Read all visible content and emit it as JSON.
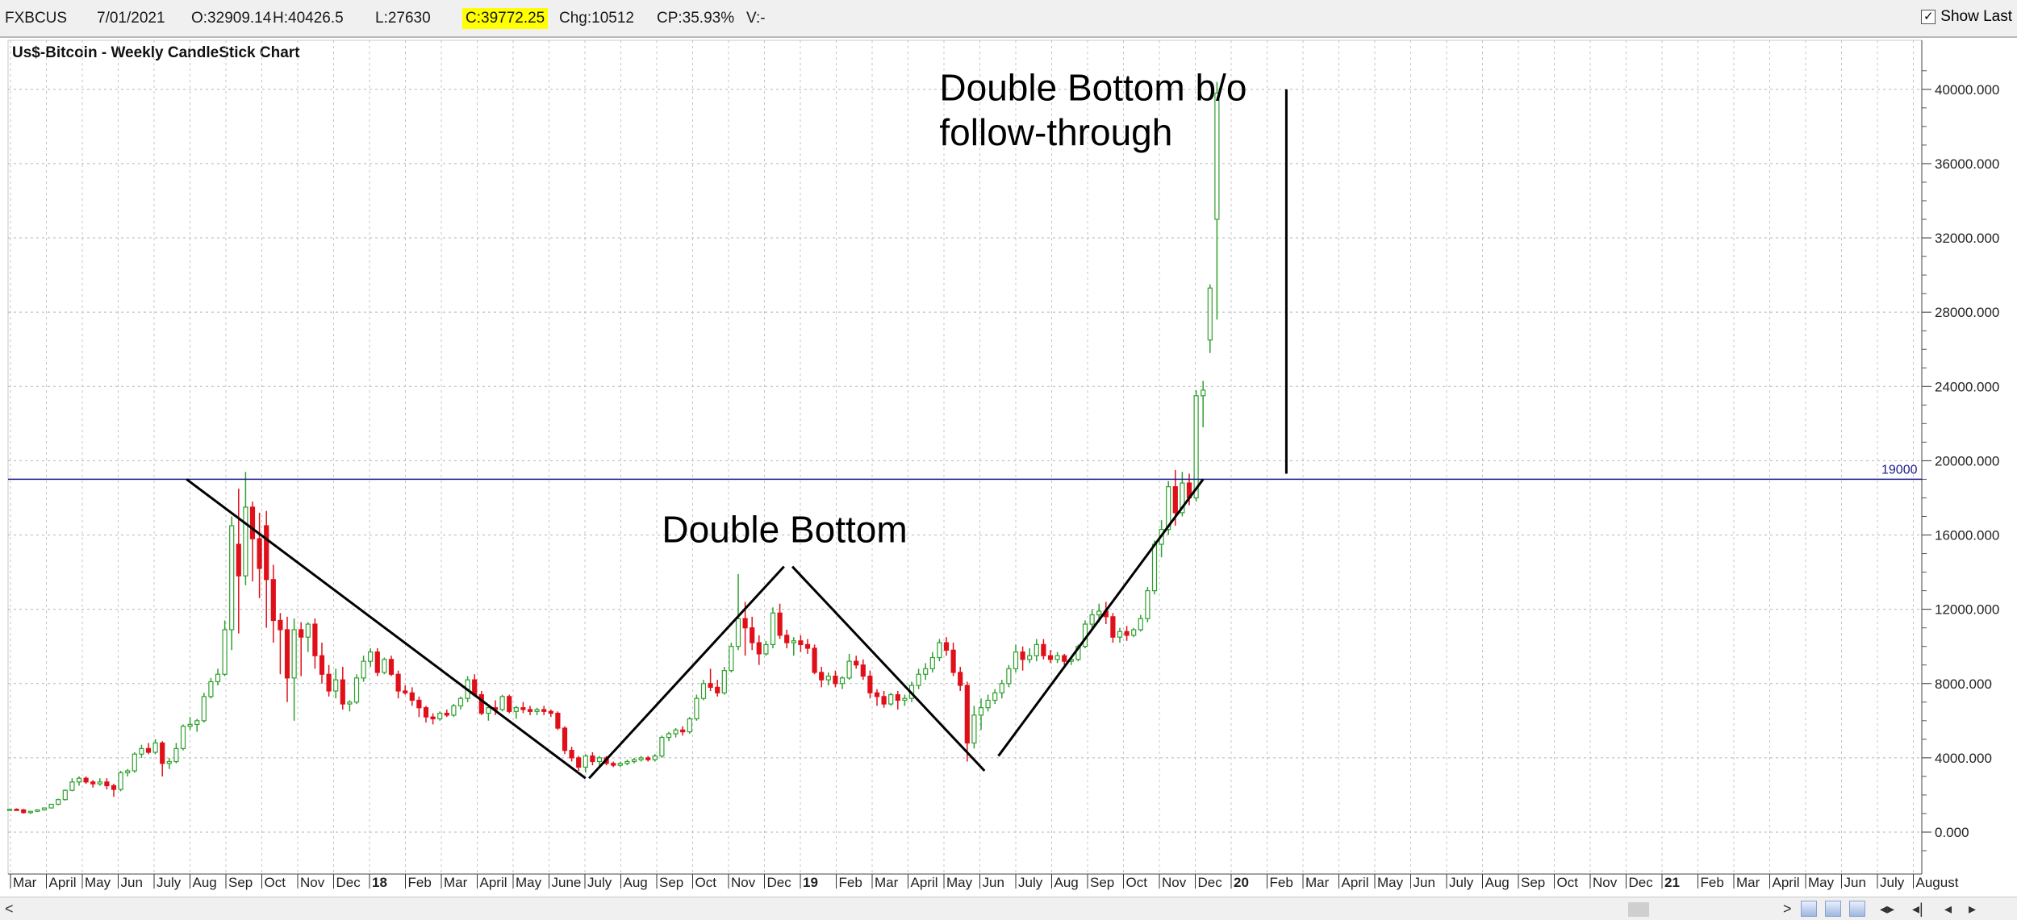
{
  "topbar": {
    "symbol": "FXBCUS",
    "date": "7/01/2021",
    "open": "O:32909.14",
    "high": "H:40426.5",
    "low": "L:27630",
    "close": "C:39772.25",
    "change": "Chg:10512",
    "change_pct": "CP:35.93%",
    "volume": "V:-",
    "show_last_label": "Show Last",
    "show_last_checked": true
  },
  "colors": {
    "up": "#2ea02e",
    "down": "#e0101a",
    "level_line": "#1c1c8c",
    "highlight": "#ffff00"
  },
  "chart_data": {
    "type": "candlestick",
    "title": "Us$-Bitcoin - Weekly CandleStick Chart",
    "ylim": [
      -1500,
      41500
    ],
    "y_ticks": [
      "0.000",
      "4000.000",
      "8000.000",
      "12000.000",
      "16000.000",
      "20000.000",
      "24000.000",
      "28000.000",
      "32000.000",
      "36000.000",
      "40000.000"
    ],
    "x_labels": [
      "Mar",
      "April",
      "May",
      "Jun",
      "July",
      "Aug",
      "Sep",
      "Oct",
      "Nov",
      "Dec",
      "18",
      "Feb",
      "Mar",
      "April",
      "May",
      "June",
      "July",
      "Aug",
      "Sep",
      "Oct",
      "Nov",
      "Dec",
      "19",
      "Feb",
      "Mar",
      "April",
      "May",
      "Jun",
      "July",
      "Aug",
      "Sep",
      "Oct",
      "Nov",
      "Dec",
      "20",
      "Feb",
      "Mar",
      "April",
      "May",
      "Jun",
      "July",
      "Aug",
      "Sep",
      "Oct",
      "Nov",
      "Dec",
      "21",
      "Feb",
      "Mar",
      "April",
      "May",
      "Jun",
      "July",
      "August"
    ],
    "bold_x_labels": [
      "18",
      "19",
      "20",
      "21"
    ],
    "horizontal_line": {
      "value": 19000,
      "label": "19000"
    },
    "candles": [
      [
        1200,
        1250,
        1180,
        1230
      ],
      [
        1230,
        1280,
        1150,
        1200
      ],
      [
        1200,
        1250,
        1000,
        1050
      ],
      [
        1050,
        1150,
        980,
        1120
      ],
      [
        1120,
        1220,
        1080,
        1200
      ],
      [
        1200,
        1320,
        1150,
        1300
      ],
      [
        1300,
        1520,
        1280,
        1500
      ],
      [
        1500,
        1800,
        1450,
        1750
      ],
      [
        1750,
        2300,
        1700,
        2250
      ],
      [
        2250,
        2900,
        2200,
        2700
      ],
      [
        2700,
        3000,
        2500,
        2900
      ],
      [
        2900,
        3000,
        2600,
        2700
      ],
      [
        2700,
        2800,
        2400,
        2600
      ],
      [
        2600,
        2900,
        2500,
        2700
      ],
      [
        2700,
        2900,
        2300,
        2500
      ],
      [
        2500,
        2600,
        1900,
        2300
      ],
      [
        2300,
        3300,
        2200,
        3200
      ],
      [
        3200,
        3400,
        3000,
        3300
      ],
      [
        3300,
        4300,
        3200,
        4200
      ],
      [
        4200,
        4700,
        4000,
        4500
      ],
      [
        4500,
        4800,
        4200,
        4300
      ],
      [
        4300,
        5000,
        4200,
        4800
      ],
      [
        4800,
        4900,
        3000,
        3700
      ],
      [
        3700,
        4000,
        3400,
        3800
      ],
      [
        3800,
        4800,
        3700,
        4500
      ],
      [
        4500,
        5800,
        4400,
        5700
      ],
      [
        5700,
        6200,
        5500,
        5800
      ],
      [
        5800,
        6100,
        5400,
        6000
      ],
      [
        6000,
        7500,
        5900,
        7300
      ],
      [
        7300,
        8300,
        7200,
        8100
      ],
      [
        8100,
        8800,
        7900,
        8500
      ],
      [
        8500,
        11400,
        8400,
        10900
      ],
      [
        10900,
        17000,
        9800,
        16500
      ],
      [
        15500,
        18500,
        10700,
        13800
      ],
      [
        13800,
        19400,
        13300,
        17500
      ],
      [
        17500,
        17800,
        13500,
        15800
      ],
      [
        15800,
        17200,
        12600,
        14200
      ],
      [
        16500,
        17300,
        11000,
        13600
      ],
      [
        13600,
        14400,
        10200,
        11400
      ],
      [
        11400,
        11800,
        8500,
        10900
      ],
      [
        10900,
        11600,
        7000,
        8300
      ],
      [
        8300,
        11500,
        6000,
        10900
      ],
      [
        10900,
        11300,
        8400,
        10500
      ],
      [
        10500,
        11300,
        9700,
        11200
      ],
      [
        11200,
        11500,
        8800,
        9500
      ],
      [
        9500,
        10200,
        8000,
        8500
      ],
      [
        8500,
        9000,
        7300,
        7600
      ],
      [
        7600,
        8800,
        7200,
        8200
      ],
      [
        8200,
        8900,
        6600,
        6900
      ],
      [
        6900,
        7100,
        6500,
        7000
      ],
      [
        7000,
        8500,
        6900,
        8300
      ],
      [
        8300,
        9500,
        8100,
        9200
      ],
      [
        9200,
        9900,
        8900,
        9700
      ],
      [
        9700,
        9900,
        8400,
        8600
      ],
      [
        8600,
        9400,
        8500,
        9300
      ],
      [
        9300,
        9500,
        8400,
        8500
      ],
      [
        8500,
        8700,
        7200,
        7600
      ],
      [
        7600,
        7900,
        7400,
        7500
      ],
      [
        7500,
        7800,
        6800,
        7100
      ],
      [
        7100,
        7300,
        6200,
        6700
      ],
      [
        6700,
        6800,
        5900,
        6200
      ],
      [
        6200,
        6400,
        5800,
        6100
      ],
      [
        6100,
        6500,
        6000,
        6400
      ],
      [
        6400,
        6600,
        6200,
        6300
      ],
      [
        6300,
        6900,
        6200,
        6800
      ],
      [
        6800,
        7300,
        6600,
        7200
      ],
      [
        7200,
        8400,
        7000,
        8200
      ],
      [
        8200,
        8500,
        7300,
        7400
      ],
      [
        7400,
        7600,
        6300,
        6400
      ],
      [
        6400,
        6800,
        6000,
        6700
      ],
      [
        6700,
        7100,
        6300,
        6600
      ],
      [
        6600,
        7400,
        6500,
        7300
      ],
      [
        7300,
        7400,
        6400,
        6500
      ],
      [
        6500,
        6800,
        6100,
        6700
      ],
      [
        6700,
        7000,
        6400,
        6600
      ],
      [
        6600,
        6800,
        6300,
        6500
      ],
      [
        6500,
        6700,
        6300,
        6600
      ],
      [
        6600,
        6800,
        6300,
        6500
      ],
      [
        6500,
        6600,
        6200,
        6400
      ],
      [
        6400,
        6500,
        5500,
        5600
      ],
      [
        5600,
        5700,
        4200,
        4400
      ],
      [
        4400,
        4600,
        3800,
        4000
      ],
      [
        4000,
        4100,
        3300,
        3500
      ],
      [
        3500,
        4200,
        3200,
        4100
      ],
      [
        4100,
        4300,
        3600,
        3800
      ],
      [
        3800,
        4100,
        3500,
        4000
      ],
      [
        4000,
        4100,
        3600,
        3700
      ],
      [
        3700,
        3800,
        3500,
        3600
      ],
      [
        3600,
        3800,
        3500,
        3700
      ],
      [
        3700,
        3900,
        3600,
        3800
      ],
      [
        3800,
        4000,
        3700,
        3900
      ],
      [
        3900,
        4100,
        3800,
        4000
      ],
      [
        4000,
        4100,
        3800,
        3900
      ],
      [
        3900,
        4200,
        3800,
        4100
      ],
      [
        4100,
        5200,
        4000,
        5100
      ],
      [
        5100,
        5400,
        4900,
        5300
      ],
      [
        5300,
        5600,
        5100,
        5500
      ],
      [
        5500,
        5700,
        5200,
        5400
      ],
      [
        5400,
        6200,
        5300,
        6100
      ],
      [
        6100,
        7400,
        6000,
        7200
      ],
      [
        7200,
        8200,
        7100,
        8000
      ],
      [
        8000,
        8800,
        7600,
        7800
      ],
      [
        7800,
        8200,
        7300,
        7500
      ],
      [
        7500,
        8900,
        7400,
        8700
      ],
      [
        8700,
        10200,
        8600,
        10000
      ],
      [
        10000,
        13900,
        9800,
        11500
      ],
      [
        11500,
        12400,
        9500,
        11000
      ],
      [
        11000,
        11600,
        9800,
        10200
      ],
      [
        10200,
        10600,
        9000,
        9600
      ],
      [
        9600,
        10300,
        9500,
        10100
      ],
      [
        10100,
        12100,
        9900,
        11800
      ],
      [
        11800,
        12300,
        10400,
        10600
      ],
      [
        10600,
        10900,
        9900,
        10200
      ],
      [
        10200,
        10500,
        9500,
        10300
      ],
      [
        10300,
        10600,
        9700,
        10100
      ],
      [
        10100,
        10400,
        9600,
        9900
      ],
      [
        9900,
        10100,
        8500,
        8600
      ],
      [
        8600,
        8900,
        7800,
        8200
      ],
      [
        8200,
        8600,
        7900,
        8400
      ],
      [
        8400,
        8700,
        7800,
        8000
      ],
      [
        8000,
        8400,
        7700,
        8300
      ],
      [
        8300,
        9600,
        8200,
        9200
      ],
      [
        9200,
        9500,
        8800,
        9000
      ],
      [
        9000,
        9300,
        8200,
        8400
      ],
      [
        8400,
        8700,
        7200,
        7500
      ],
      [
        7500,
        7700,
        6800,
        7300
      ],
      [
        7300,
        7600,
        6700,
        6900
      ],
      [
        6900,
        7500,
        6800,
        7400
      ],
      [
        7400,
        7600,
        6600,
        7100
      ],
      [
        7100,
        7400,
        6800,
        7200
      ],
      [
        7200,
        8100,
        7000,
        7900
      ],
      [
        7900,
        8800,
        7700,
        8500
      ],
      [
        8500,
        9100,
        8200,
        8800
      ],
      [
        8800,
        9700,
        8600,
        9400
      ],
      [
        9400,
        10400,
        9200,
        10200
      ],
      [
        10200,
        10500,
        9500,
        9800
      ],
      [
        9800,
        10200,
        8400,
        8600
      ],
      [
        8600,
        8900,
        7600,
        7900
      ],
      [
        7900,
        8100,
        3800,
        4800
      ],
      [
        4800,
        6800,
        4500,
        6300
      ],
      [
        6300,
        7200,
        5500,
        6700
      ],
      [
        6700,
        7400,
        6500,
        7100
      ],
      [
        7100,
        7700,
        6900,
        7500
      ],
      [
        7500,
        8200,
        7200,
        8000
      ],
      [
        8000,
        9000,
        7800,
        8800
      ],
      [
        8800,
        10100,
        8600,
        9700
      ],
      [
        9700,
        10000,
        8700,
        9300
      ],
      [
        9300,
        9900,
        9100,
        9500
      ],
      [
        9500,
        10400,
        9200,
        10100
      ],
      [
        10100,
        10400,
        9300,
        9500
      ],
      [
        9500,
        9800,
        9100,
        9300
      ],
      [
        9300,
        9700,
        9100,
        9500
      ],
      [
        9500,
        9600,
        9000,
        9200
      ],
      [
        9200,
        9400,
        9000,
        9300
      ],
      [
        9300,
        10100,
        9200,
        10000
      ],
      [
        10000,
        11400,
        9900,
        11200
      ],
      [
        11200,
        12000,
        10900,
        11700
      ],
      [
        11700,
        12300,
        11300,
        11900
      ],
      [
        11900,
        12400,
        11200,
        11600
      ],
      [
        11600,
        11800,
        10200,
        10500
      ],
      [
        10500,
        11000,
        10200,
        10800
      ],
      [
        10800,
        11100,
        10300,
        10600
      ],
      [
        10600,
        11000,
        10500,
        10900
      ],
      [
        10900,
        11700,
        10800,
        11500
      ],
      [
        11500,
        13200,
        11300,
        13000
      ],
      [
        13000,
        15700,
        12800,
        15500
      ],
      [
        15500,
        16800,
        14800,
        16300
      ],
      [
        16300,
        18900,
        16000,
        18600
      ],
      [
        18600,
        19500,
        16500,
        17200
      ],
      [
        17200,
        19400,
        17000,
        18800
      ],
      [
        18800,
        19300,
        17600,
        18000
      ],
      [
        18000,
        23800,
        17800,
        23500
      ],
      [
        23500,
        24300,
        21800,
        23800
      ],
      [
        26500,
        29500,
        25800,
        29300
      ],
      [
        33000,
        40400,
        27600,
        39800
      ]
    ],
    "annotations": [
      {
        "text": "Double Bottom b/o",
        "value_x": 134,
        "value_y": 39400
      },
      {
        "text": "follow-through",
        "value_x": 134,
        "value_y": 37000
      },
      {
        "text": "Double Bottom",
        "value_x": 94,
        "value_y": 15600
      }
    ],
    "trendlines": [
      {
        "from": [
          25.5,
          19000
        ],
        "to": [
          83,
          2900
        ]
      },
      {
        "from": [
          83.5,
          2900
        ],
        "to": [
          111.6,
          14300
        ]
      },
      {
        "from": [
          112.8,
          14300
        ],
        "to": [
          140.5,
          3300
        ]
      },
      {
        "from": [
          142.5,
          4100
        ],
        "to": [
          172,
          19000
        ]
      },
      {
        "from": [
          184,
          40000
        ],
        "to": [
          184,
          19300
        ]
      }
    ]
  }
}
